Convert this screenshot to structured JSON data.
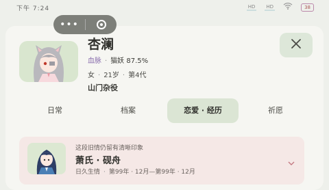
{
  "status_bar": {
    "time": "下午 7:24",
    "signal1": "HD",
    "signal2": "HD",
    "wifi": "wifi",
    "battery": "38"
  },
  "capsule": {
    "more_label": "•••",
    "more_icon": "more-dots-icon",
    "target_icon": "target-icon"
  },
  "profile": {
    "name": "杏澜",
    "bloodline_label": "血脉",
    "bloodline_value": "猫妖 87.5%",
    "gender": "女",
    "age": "21岁",
    "generation": "第4代",
    "role": "山门杂役"
  },
  "close_icon": "close-icon",
  "tabs": [
    {
      "label": "日常",
      "active": false
    },
    {
      "label": "档案",
      "active": false
    },
    {
      "label": "恋爱 · 经历",
      "active": true
    },
    {
      "label": "祈愿",
      "active": false
    }
  ],
  "relationship_card": {
    "note": "这段旧情仍留有清晰印象",
    "name": "萧氏 · 砚舟",
    "status": "日久生情",
    "period": "第99年 · 12月—第99年 · 12月"
  },
  "colors": {
    "accent": "#dbe5d4",
    "bloodline": "#8a6fae",
    "card_bg": "#f5e8e6",
    "chevron": "#c47a82"
  }
}
